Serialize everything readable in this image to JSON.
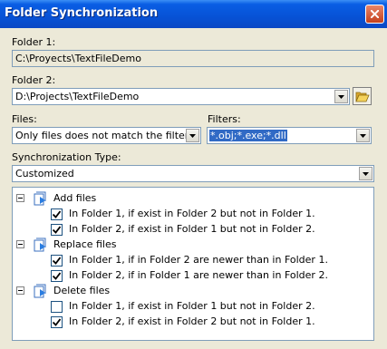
{
  "window": {
    "title": "Folder Synchronization"
  },
  "folder1": {
    "label": "Folder 1:",
    "value": "C:\\Proyects\\TextFileDemo"
  },
  "folder2": {
    "label": "Folder 2:",
    "value": "D:\\Projects\\TextFileDemo"
  },
  "files": {
    "label": "Files:",
    "selected": "Only files does not match the filters"
  },
  "filters": {
    "label": "Filters:",
    "value": "*.obj;*.exe;*.dll"
  },
  "sync_type": {
    "label": "Synchronization Type:",
    "selected": "Customized"
  },
  "tree": {
    "groups": [
      {
        "label": "Add files",
        "icon": "add-files-icon",
        "items": [
          {
            "label": "In Folder 1, if exist in Folder 2 but not in Folder 1.",
            "checked": true
          },
          {
            "label": "In Folder 2, if exist in Folder 1 but not in Folder 2.",
            "checked": true
          }
        ]
      },
      {
        "label": "Replace files",
        "icon": "replace-files-icon",
        "items": [
          {
            "label": "In Folder 1, if in Folder 2 are newer than in Folder 1.",
            "checked": true
          },
          {
            "label": "In Folder 2, if in Folder 1 are newer than in Folder 2.",
            "checked": true
          }
        ]
      },
      {
        "label": "Delete files",
        "icon": "delete-files-icon",
        "items": [
          {
            "label": "In Folder 1, if exist in Folder 1 but not in Folder 2.",
            "checked": false
          },
          {
            "label": "In Folder 2, if exist in Folder 2 but not in Folder 1.",
            "checked": true
          }
        ]
      }
    ]
  },
  "colors": {
    "titlebar": "#0752d6",
    "selection": "#316ac5",
    "border": "#7f9db9",
    "dialog_bg": "#ece9d8"
  }
}
